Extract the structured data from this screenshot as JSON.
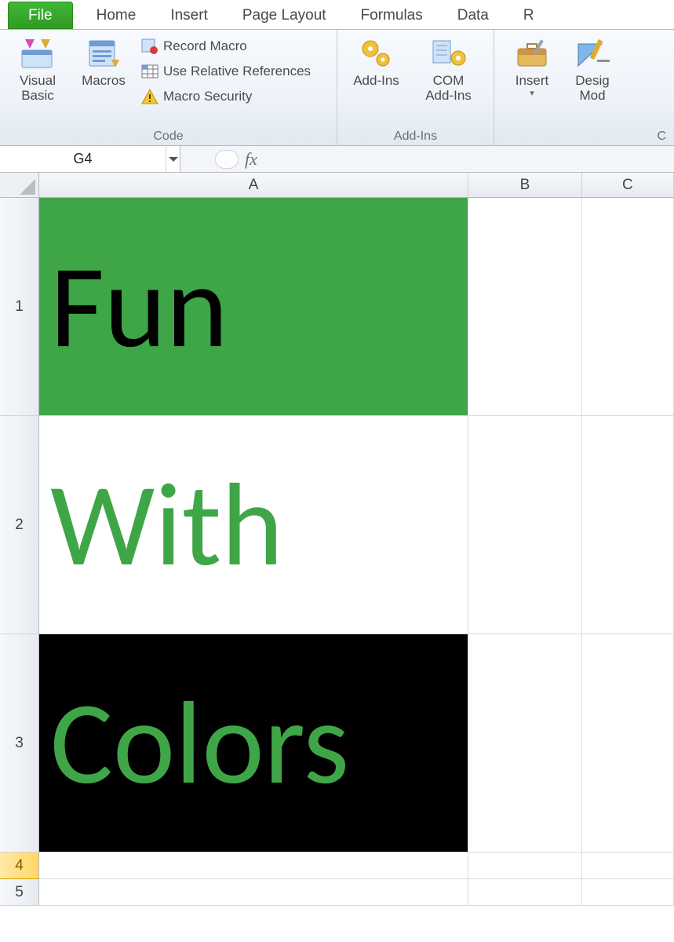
{
  "tabs": {
    "file": "File",
    "home": "Home",
    "insert": "Insert",
    "pagelayout": "Page Layout",
    "formulas": "Formulas",
    "data": "Data",
    "review_partial": "R"
  },
  "ribbon": {
    "code": {
      "visual_basic": "Visual\nBasic",
      "macros": "Macros",
      "record_macro": "Record Macro",
      "use_relative": "Use Relative References",
      "macro_security": "Macro Security",
      "group_label": "Code"
    },
    "addins": {
      "addins": "Add-Ins",
      "com_addins": "COM\nAdd-Ins",
      "group_label": "Add-Ins"
    },
    "controls": {
      "insert": "Insert",
      "design_mode": "Desig\nMod",
      "group_label_partial": "C"
    }
  },
  "name_box": "G4",
  "fx_label": "fx",
  "columns": [
    "A",
    "B",
    "C"
  ],
  "rows": [
    "1",
    "2",
    "3",
    "4",
    "5"
  ],
  "cells": {
    "A1": "Fun",
    "A2": "With",
    "A3": "Colors"
  },
  "colors": {
    "excel_green": "#3fa648",
    "black": "#000000",
    "white": "#ffffff"
  }
}
